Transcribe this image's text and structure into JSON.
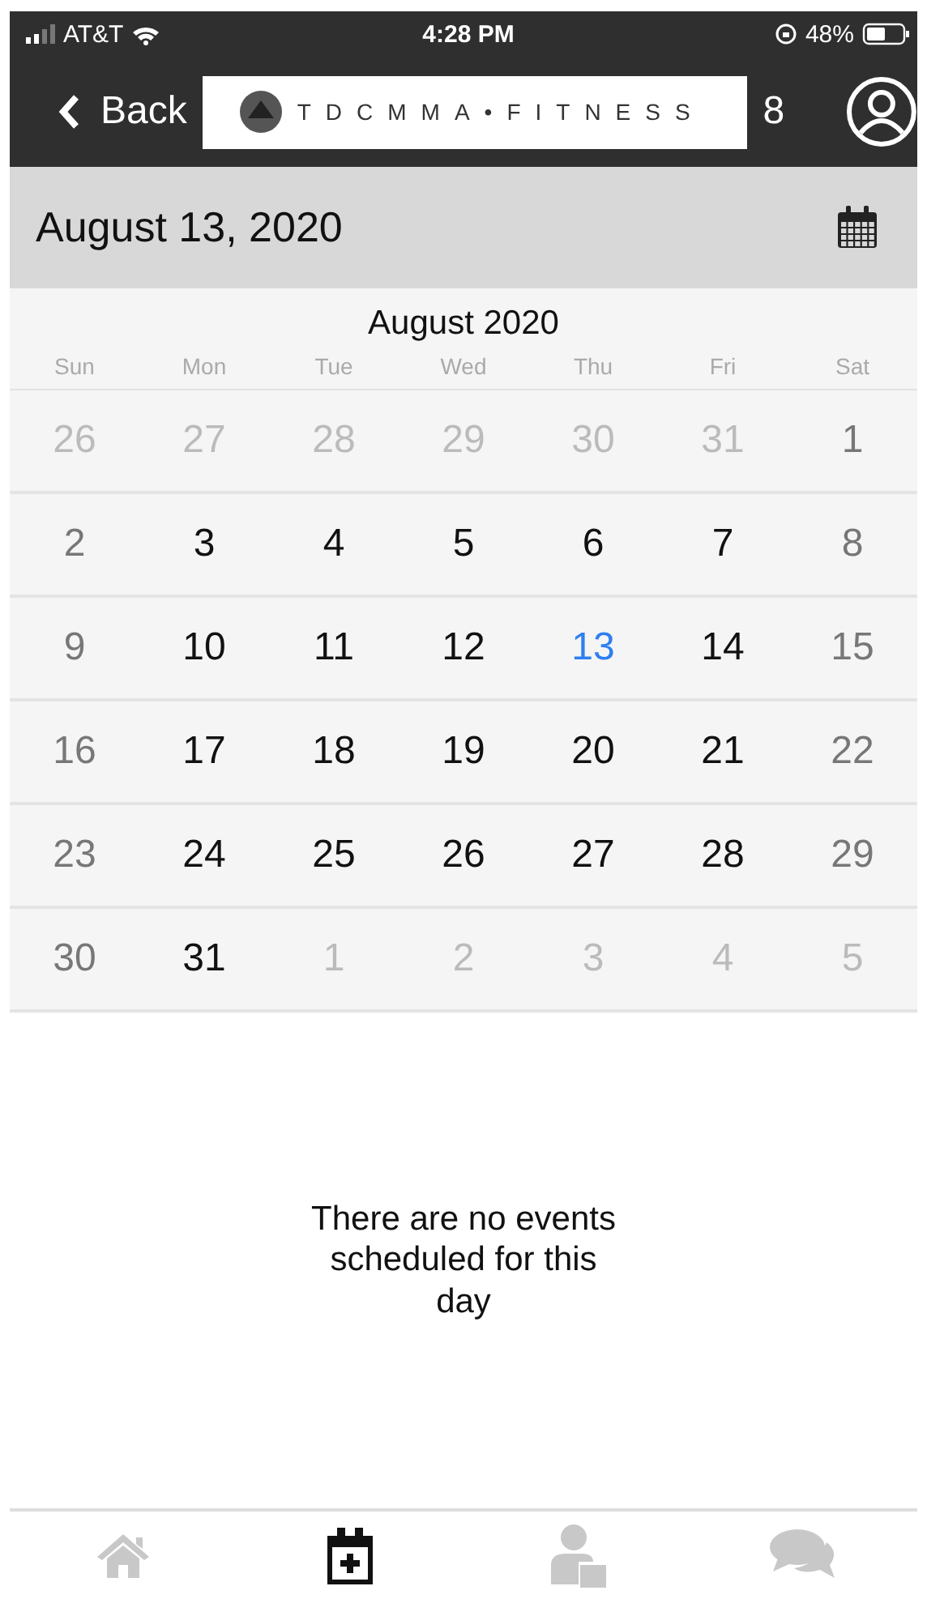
{
  "status_bar": {
    "carrier": "AT&T",
    "time": "4:28 PM",
    "battery": "48%"
  },
  "nav_bar": {
    "back": "Back",
    "logo_text": "TDCMMA•FITNESS",
    "badge": "8"
  },
  "date_bar": {
    "date": "August 13, 2020"
  },
  "calendar": {
    "month": "August 2020",
    "weekdays": [
      "Sun",
      "Mon",
      "Tue",
      "Wed",
      "Thu",
      "Fri",
      "Sat"
    ],
    "weeks": [
      [
        {
          "day": "26",
          "kind": "outside",
          "selected": false
        },
        {
          "day": "27",
          "kind": "outside",
          "selected": false
        },
        {
          "day": "28",
          "kind": "outside",
          "selected": false
        },
        {
          "day": "29",
          "kind": "outside",
          "selected": false
        },
        {
          "day": "30",
          "kind": "outside",
          "selected": false
        },
        {
          "day": "31",
          "kind": "outside",
          "selected": false
        },
        {
          "day": "1",
          "kind": "weekend",
          "selected": false
        }
      ],
      [
        {
          "day": "2",
          "kind": "weekend",
          "selected": false
        },
        {
          "day": "3",
          "kind": "weekday",
          "selected": false
        },
        {
          "day": "4",
          "kind": "weekday",
          "selected": false
        },
        {
          "day": "5",
          "kind": "weekday",
          "selected": false
        },
        {
          "day": "6",
          "kind": "weekday",
          "selected": false
        },
        {
          "day": "7",
          "kind": "weekday",
          "selected": false
        },
        {
          "day": "8",
          "kind": "weekend",
          "selected": false
        }
      ],
      [
        {
          "day": "9",
          "kind": "weekend",
          "selected": false
        },
        {
          "day": "10",
          "kind": "weekday",
          "selected": false
        },
        {
          "day": "11",
          "kind": "weekday",
          "selected": false
        },
        {
          "day": "12",
          "kind": "weekday",
          "selected": false
        },
        {
          "day": "13",
          "kind": "weekday",
          "selected": true
        },
        {
          "day": "14",
          "kind": "weekday",
          "selected": false
        },
        {
          "day": "15",
          "kind": "weekend",
          "selected": false
        }
      ],
      [
        {
          "day": "16",
          "kind": "weekend",
          "selected": false
        },
        {
          "day": "17",
          "kind": "weekday",
          "selected": false
        },
        {
          "day": "18",
          "kind": "weekday",
          "selected": false
        },
        {
          "day": "19",
          "kind": "weekday",
          "selected": false
        },
        {
          "day": "20",
          "kind": "weekday",
          "selected": false
        },
        {
          "day": "21",
          "kind": "weekday",
          "selected": false
        },
        {
          "day": "22",
          "kind": "weekend",
          "selected": false
        }
      ],
      [
        {
          "day": "23",
          "kind": "weekend",
          "selected": false
        },
        {
          "day": "24",
          "kind": "weekday",
          "selected": false
        },
        {
          "day": "25",
          "kind": "weekday",
          "selected": false
        },
        {
          "day": "26",
          "kind": "weekday",
          "selected": false
        },
        {
          "day": "27",
          "kind": "weekday",
          "selected": false
        },
        {
          "day": "28",
          "kind": "weekday",
          "selected": false
        },
        {
          "day": "29",
          "kind": "weekend",
          "selected": false
        }
      ],
      [
        {
          "day": "30",
          "kind": "weekend",
          "selected": false
        },
        {
          "day": "31",
          "kind": "weekday",
          "selected": false
        },
        {
          "day": "1",
          "kind": "outside",
          "selected": false
        },
        {
          "day": "2",
          "kind": "outside",
          "selected": false
        },
        {
          "day": "3",
          "kind": "outside",
          "selected": false
        },
        {
          "day": "4",
          "kind": "outside",
          "selected": false
        },
        {
          "day": "5",
          "kind": "outside",
          "selected": false
        }
      ]
    ]
  },
  "empty_message": "There are no events scheduled for this day",
  "tab_bar": [
    {
      "kind": "home",
      "selected": false
    },
    {
      "kind": "calendar-add",
      "selected": true
    },
    {
      "kind": "person-calendar",
      "selected": false
    },
    {
      "kind": "chat",
      "selected": false
    }
  ]
}
